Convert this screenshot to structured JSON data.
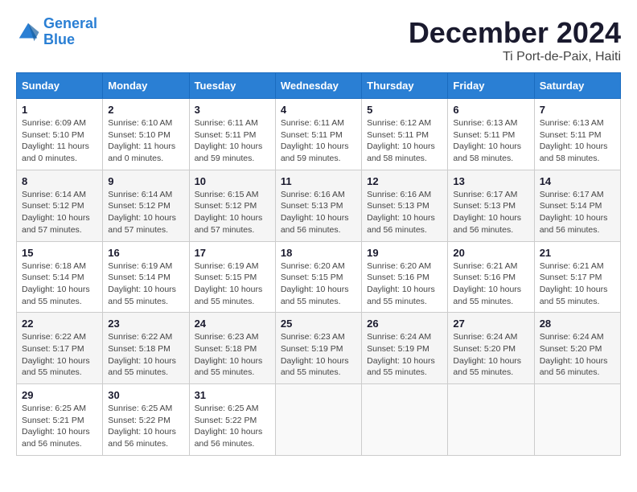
{
  "logo": {
    "line1": "General",
    "line2": "Blue"
  },
  "title": "December 2024",
  "subtitle": "Ti Port-de-Paix, Haiti",
  "days_of_week": [
    "Sunday",
    "Monday",
    "Tuesday",
    "Wednesday",
    "Thursday",
    "Friday",
    "Saturday"
  ],
  "weeks": [
    [
      {
        "day": "1",
        "sunrise": "6:09 AM",
        "sunset": "5:10 PM",
        "daylight": "11 hours and 0 minutes."
      },
      {
        "day": "2",
        "sunrise": "6:10 AM",
        "sunset": "5:10 PM",
        "daylight": "11 hours and 0 minutes."
      },
      {
        "day": "3",
        "sunrise": "6:11 AM",
        "sunset": "5:11 PM",
        "daylight": "10 hours and 59 minutes."
      },
      {
        "day": "4",
        "sunrise": "6:11 AM",
        "sunset": "5:11 PM",
        "daylight": "10 hours and 59 minutes."
      },
      {
        "day": "5",
        "sunrise": "6:12 AM",
        "sunset": "5:11 PM",
        "daylight": "10 hours and 58 minutes."
      },
      {
        "day": "6",
        "sunrise": "6:13 AM",
        "sunset": "5:11 PM",
        "daylight": "10 hours and 58 minutes."
      },
      {
        "day": "7",
        "sunrise": "6:13 AM",
        "sunset": "5:11 PM",
        "daylight": "10 hours and 58 minutes."
      }
    ],
    [
      {
        "day": "8",
        "sunrise": "6:14 AM",
        "sunset": "5:12 PM",
        "daylight": "10 hours and 57 minutes."
      },
      {
        "day": "9",
        "sunrise": "6:14 AM",
        "sunset": "5:12 PM",
        "daylight": "10 hours and 57 minutes."
      },
      {
        "day": "10",
        "sunrise": "6:15 AM",
        "sunset": "5:12 PM",
        "daylight": "10 hours and 57 minutes."
      },
      {
        "day": "11",
        "sunrise": "6:16 AM",
        "sunset": "5:13 PM",
        "daylight": "10 hours and 56 minutes."
      },
      {
        "day": "12",
        "sunrise": "6:16 AM",
        "sunset": "5:13 PM",
        "daylight": "10 hours and 56 minutes."
      },
      {
        "day": "13",
        "sunrise": "6:17 AM",
        "sunset": "5:13 PM",
        "daylight": "10 hours and 56 minutes."
      },
      {
        "day": "14",
        "sunrise": "6:17 AM",
        "sunset": "5:14 PM",
        "daylight": "10 hours and 56 minutes."
      }
    ],
    [
      {
        "day": "15",
        "sunrise": "6:18 AM",
        "sunset": "5:14 PM",
        "daylight": "10 hours and 55 minutes."
      },
      {
        "day": "16",
        "sunrise": "6:19 AM",
        "sunset": "5:14 PM",
        "daylight": "10 hours and 55 minutes."
      },
      {
        "day": "17",
        "sunrise": "6:19 AM",
        "sunset": "5:15 PM",
        "daylight": "10 hours and 55 minutes."
      },
      {
        "day": "18",
        "sunrise": "6:20 AM",
        "sunset": "5:15 PM",
        "daylight": "10 hours and 55 minutes."
      },
      {
        "day": "19",
        "sunrise": "6:20 AM",
        "sunset": "5:16 PM",
        "daylight": "10 hours and 55 minutes."
      },
      {
        "day": "20",
        "sunrise": "6:21 AM",
        "sunset": "5:16 PM",
        "daylight": "10 hours and 55 minutes."
      },
      {
        "day": "21",
        "sunrise": "6:21 AM",
        "sunset": "5:17 PM",
        "daylight": "10 hours and 55 minutes."
      }
    ],
    [
      {
        "day": "22",
        "sunrise": "6:22 AM",
        "sunset": "5:17 PM",
        "daylight": "10 hours and 55 minutes."
      },
      {
        "day": "23",
        "sunrise": "6:22 AM",
        "sunset": "5:18 PM",
        "daylight": "10 hours and 55 minutes."
      },
      {
        "day": "24",
        "sunrise": "6:23 AM",
        "sunset": "5:18 PM",
        "daylight": "10 hours and 55 minutes."
      },
      {
        "day": "25",
        "sunrise": "6:23 AM",
        "sunset": "5:19 PM",
        "daylight": "10 hours and 55 minutes."
      },
      {
        "day": "26",
        "sunrise": "6:24 AM",
        "sunset": "5:19 PM",
        "daylight": "10 hours and 55 minutes."
      },
      {
        "day": "27",
        "sunrise": "6:24 AM",
        "sunset": "5:20 PM",
        "daylight": "10 hours and 55 minutes."
      },
      {
        "day": "28",
        "sunrise": "6:24 AM",
        "sunset": "5:20 PM",
        "daylight": "10 hours and 56 minutes."
      }
    ],
    [
      {
        "day": "29",
        "sunrise": "6:25 AM",
        "sunset": "5:21 PM",
        "daylight": "10 hours and 56 minutes."
      },
      {
        "day": "30",
        "sunrise": "6:25 AM",
        "sunset": "5:22 PM",
        "daylight": "10 hours and 56 minutes."
      },
      {
        "day": "31",
        "sunrise": "6:25 AM",
        "sunset": "5:22 PM",
        "daylight": "10 hours and 56 minutes."
      },
      null,
      null,
      null,
      null
    ]
  ]
}
